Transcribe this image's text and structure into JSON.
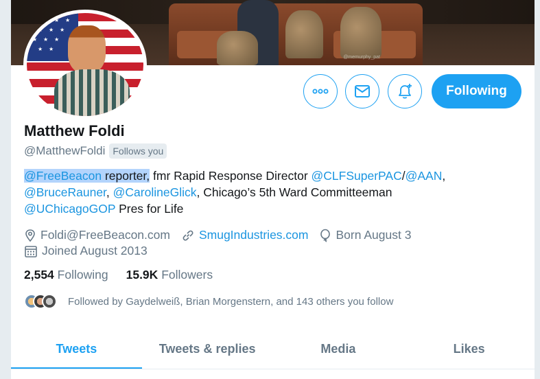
{
  "banner": {
    "watermark": "@memurphy_pat"
  },
  "profile": {
    "name": "Matthew Foldi",
    "handle": "@MatthewFoldi",
    "follows_you": "Follows you"
  },
  "actions": {
    "more_icon": "more-icon",
    "message_icon": "message-icon",
    "notify_icon": "bell-plus-icon",
    "following_label": "Following"
  },
  "bio": {
    "mention1": "@FreeBeacon",
    "text1": " reporter,",
    "text2": " fmr Rapid Response Director ",
    "mention2": "@CLFSuperPAC",
    "slash": "/",
    "mention3": "@AAN",
    "comma1": ",",
    "mention4": "@BruceRauner",
    "comma2": ", ",
    "mention5": "@CarolineGlick",
    "text3": ", Chicago’s 5th Ward Committeeman",
    "mention6": "@UChicagoGOP",
    "text4": " Pres for Life"
  },
  "meta": {
    "location": "Foldi@FreeBeacon.com",
    "website": "SmugIndustries.com",
    "birthday": "Born August 3",
    "joined": "Joined August 2013"
  },
  "stats": {
    "following_count": "2,554",
    "following_label": "Following",
    "followers_count": "15.9K",
    "followers_label": "Followers"
  },
  "followed_by": "Followed by Gaydelweiß, Brian Morgenstern, and 143 others you follow",
  "tabs": [
    {
      "label": "Tweets",
      "active": true
    },
    {
      "label": "Tweets & replies",
      "active": false
    },
    {
      "label": "Media",
      "active": false
    },
    {
      "label": "Likes",
      "active": false
    }
  ],
  "colors": {
    "accent": "#1da1f2",
    "link": "#1b95e0",
    "muted": "#657786"
  }
}
